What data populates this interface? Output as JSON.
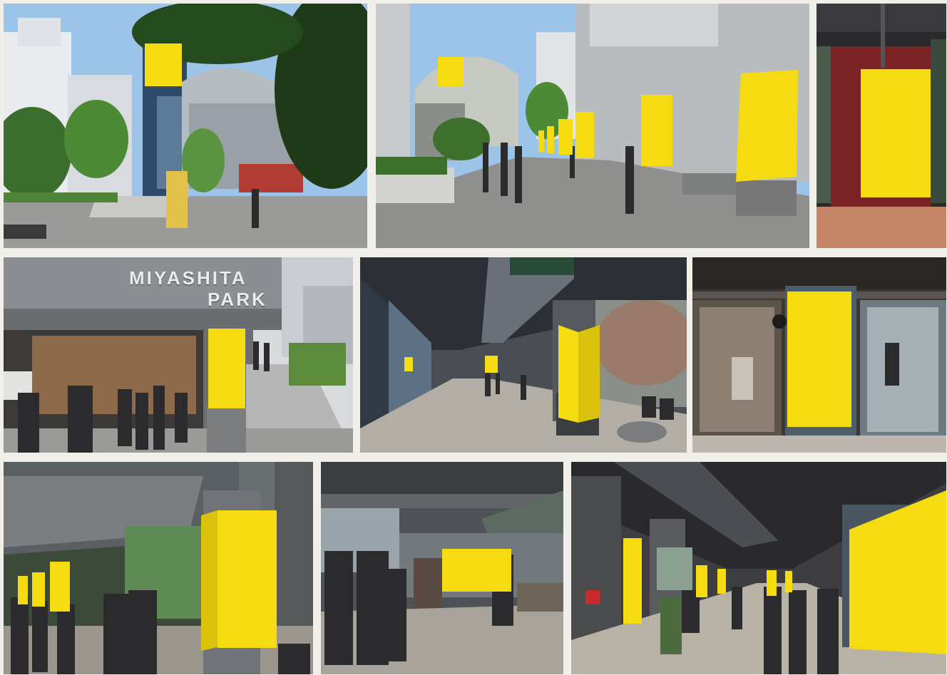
{
  "photos": [
    {
      "scene": "exterior-street-tower"
    },
    {
      "scene": "exterior-walkway-columns"
    },
    {
      "scene": "interior-red-column"
    },
    {
      "scene": "park-entrance-stairs"
    },
    {
      "scene": "corridor-glass-columns"
    },
    {
      "scene": "storefront-panel"
    },
    {
      "scene": "covered-walk-columns"
    },
    {
      "scene": "escalator-hall-panel"
    },
    {
      "scene": "arcade-large-panel"
    }
  ],
  "signage": {
    "line1": "MIYASHITA",
    "line2": "PARK"
  },
  "colors": {
    "ad_yellow": "#f5dc12",
    "background": "#f0efea"
  }
}
